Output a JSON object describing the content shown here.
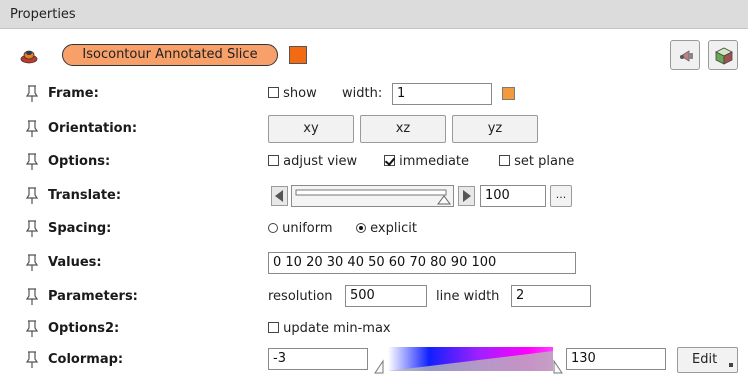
{
  "title": "Properties",
  "module": {
    "name": "Isocontour Annotated Slice",
    "color": "#f36a12"
  },
  "rows": [
    {
      "label": "Frame:"
    },
    {
      "label": "Orientation:"
    },
    {
      "label": "Options:"
    },
    {
      "label": "Translate:"
    },
    {
      "label": "Spacing:"
    },
    {
      "label": "Values:"
    },
    {
      "label": "Parameters:"
    },
    {
      "label": "Options2:"
    },
    {
      "label": "Colormap:"
    }
  ],
  "frame": {
    "show_label": "show",
    "show_checked": false,
    "width_label": "width:",
    "width_value": "1",
    "color": "#f59a3c"
  },
  "orientation": {
    "buttons": [
      "xy",
      "xz",
      "yz"
    ]
  },
  "options": {
    "adjust_view_label": "adjust view",
    "adjust_view_checked": false,
    "immediate_label": "immediate",
    "immediate_checked": true,
    "set_plane_label": "set plane",
    "set_plane_checked": false
  },
  "translate": {
    "value": "100",
    "more_label": "...",
    "slider_fraction": 1.0
  },
  "spacing": {
    "uniform_label": "uniform",
    "explicit_label": "explicit",
    "selected": "explicit"
  },
  "values": {
    "text": "0 10 20 30 40 50 60 70 80 90 100"
  },
  "parameters": {
    "resolution_label": "resolution",
    "resolution_value": "500",
    "line_width_label": "line width",
    "line_width_value": "2"
  },
  "options2": {
    "update_label": "update min-max",
    "update_checked": false
  },
  "colormap": {
    "min": "-3",
    "max": "130",
    "edit_label": "Edit"
  }
}
